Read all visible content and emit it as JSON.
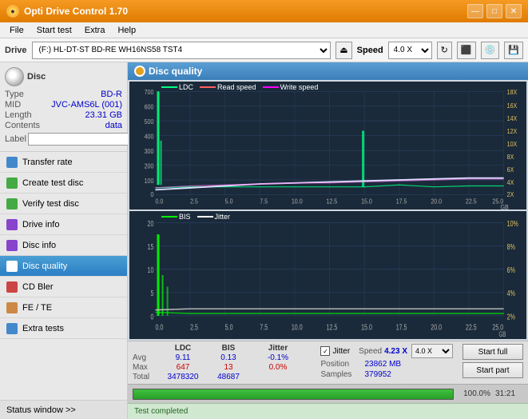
{
  "window": {
    "title": "Opti Drive Control 1.70",
    "minimize": "—",
    "maximize": "□",
    "close": "✕"
  },
  "menu": {
    "items": [
      "File",
      "Start test",
      "Extra",
      "Help"
    ]
  },
  "drive_bar": {
    "label": "Drive",
    "drive_value": "(F:)  HL-DT-ST BD-RE  WH16NS58 TST4",
    "eject_label": "⏏",
    "speed_label": "Speed",
    "speed_value": "4.0 X"
  },
  "disc": {
    "type_label": "Type",
    "type_value": "BD-R",
    "mid_label": "MID",
    "mid_value": "JVC-AMS6L (001)",
    "length_label": "Length",
    "length_value": "23.31 GB",
    "contents_label": "Contents",
    "contents_value": "data",
    "label_label": "Label",
    "label_value": ""
  },
  "nav": {
    "items": [
      {
        "id": "transfer-rate",
        "label": "Transfer rate",
        "active": false
      },
      {
        "id": "create-test-disc",
        "label": "Create test disc",
        "active": false
      },
      {
        "id": "verify-test-disc",
        "label": "Verify test disc",
        "active": false
      },
      {
        "id": "drive-info",
        "label": "Drive info",
        "active": false
      },
      {
        "id": "disc-info",
        "label": "Disc info",
        "active": false
      },
      {
        "id": "disc-quality",
        "label": "Disc quality",
        "active": true
      },
      {
        "id": "cd-bler",
        "label": "CD Bler",
        "active": false
      },
      {
        "id": "fe-te",
        "label": "FE / TE",
        "active": false
      },
      {
        "id": "extra-tests",
        "label": "Extra tests",
        "active": false
      }
    ]
  },
  "status_window": {
    "label": "Status window >>"
  },
  "disc_quality": {
    "title": "Disc quality"
  },
  "chart1": {
    "legend": [
      {
        "label": "LDC",
        "color": "#00ff80"
      },
      {
        "label": "Read speed",
        "color": "#ff6060"
      },
      {
        "label": "Write speed",
        "color": "#ff00ff"
      }
    ],
    "y_left": [
      "700",
      "600",
      "500",
      "400",
      "300",
      "200",
      "100",
      "0"
    ],
    "y_right": [
      "18X",
      "16X",
      "14X",
      "12X",
      "10X",
      "8X",
      "6X",
      "4X",
      "2X"
    ],
    "x_labels": [
      "0.0",
      "2.5",
      "5.0",
      "7.5",
      "10.0",
      "12.5",
      "15.0",
      "17.5",
      "20.0",
      "22.5",
      "25.0 GB"
    ]
  },
  "chart2": {
    "legend": [
      {
        "label": "BIS",
        "color": "#00ff00"
      },
      {
        "label": "Jitter",
        "color": "#ffffff"
      }
    ],
    "y_left": [
      "20",
      "15",
      "10",
      "5",
      "0"
    ],
    "y_right": [
      "10%",
      "8%",
      "6%",
      "4%",
      "2%"
    ],
    "x_labels": [
      "0.0",
      "2.5",
      "5.0",
      "7.5",
      "10.0",
      "12.5",
      "15.0",
      "17.5",
      "20.0",
      "22.5",
      "25.0 GB"
    ]
  },
  "stats": {
    "headers": [
      "",
      "LDC",
      "BIS",
      "",
      "Jitter"
    ],
    "rows": [
      {
        "label": "Avg",
        "ldc": "9.11",
        "bis": "0.13",
        "jitter": "-0.1%"
      },
      {
        "label": "Max",
        "ldc": "647",
        "bis": "13",
        "jitter": "0.0%"
      },
      {
        "label": "Total",
        "ldc": "3478320",
        "bis": "48687",
        "jitter": ""
      }
    ],
    "jitter_checked": true,
    "speed_label": "Speed",
    "speed_value": "4.23 X",
    "speed_dropdown": "4.0 X",
    "position_label": "Position",
    "position_value": "23862 MB",
    "samples_label": "Samples",
    "samples_value": "379952",
    "start_full_label": "Start full",
    "start_part_label": "Start part"
  },
  "progress": {
    "percent": "100.0%",
    "bar_width": "100",
    "time": "31:21"
  },
  "status": {
    "completed_text": "Test completed"
  }
}
